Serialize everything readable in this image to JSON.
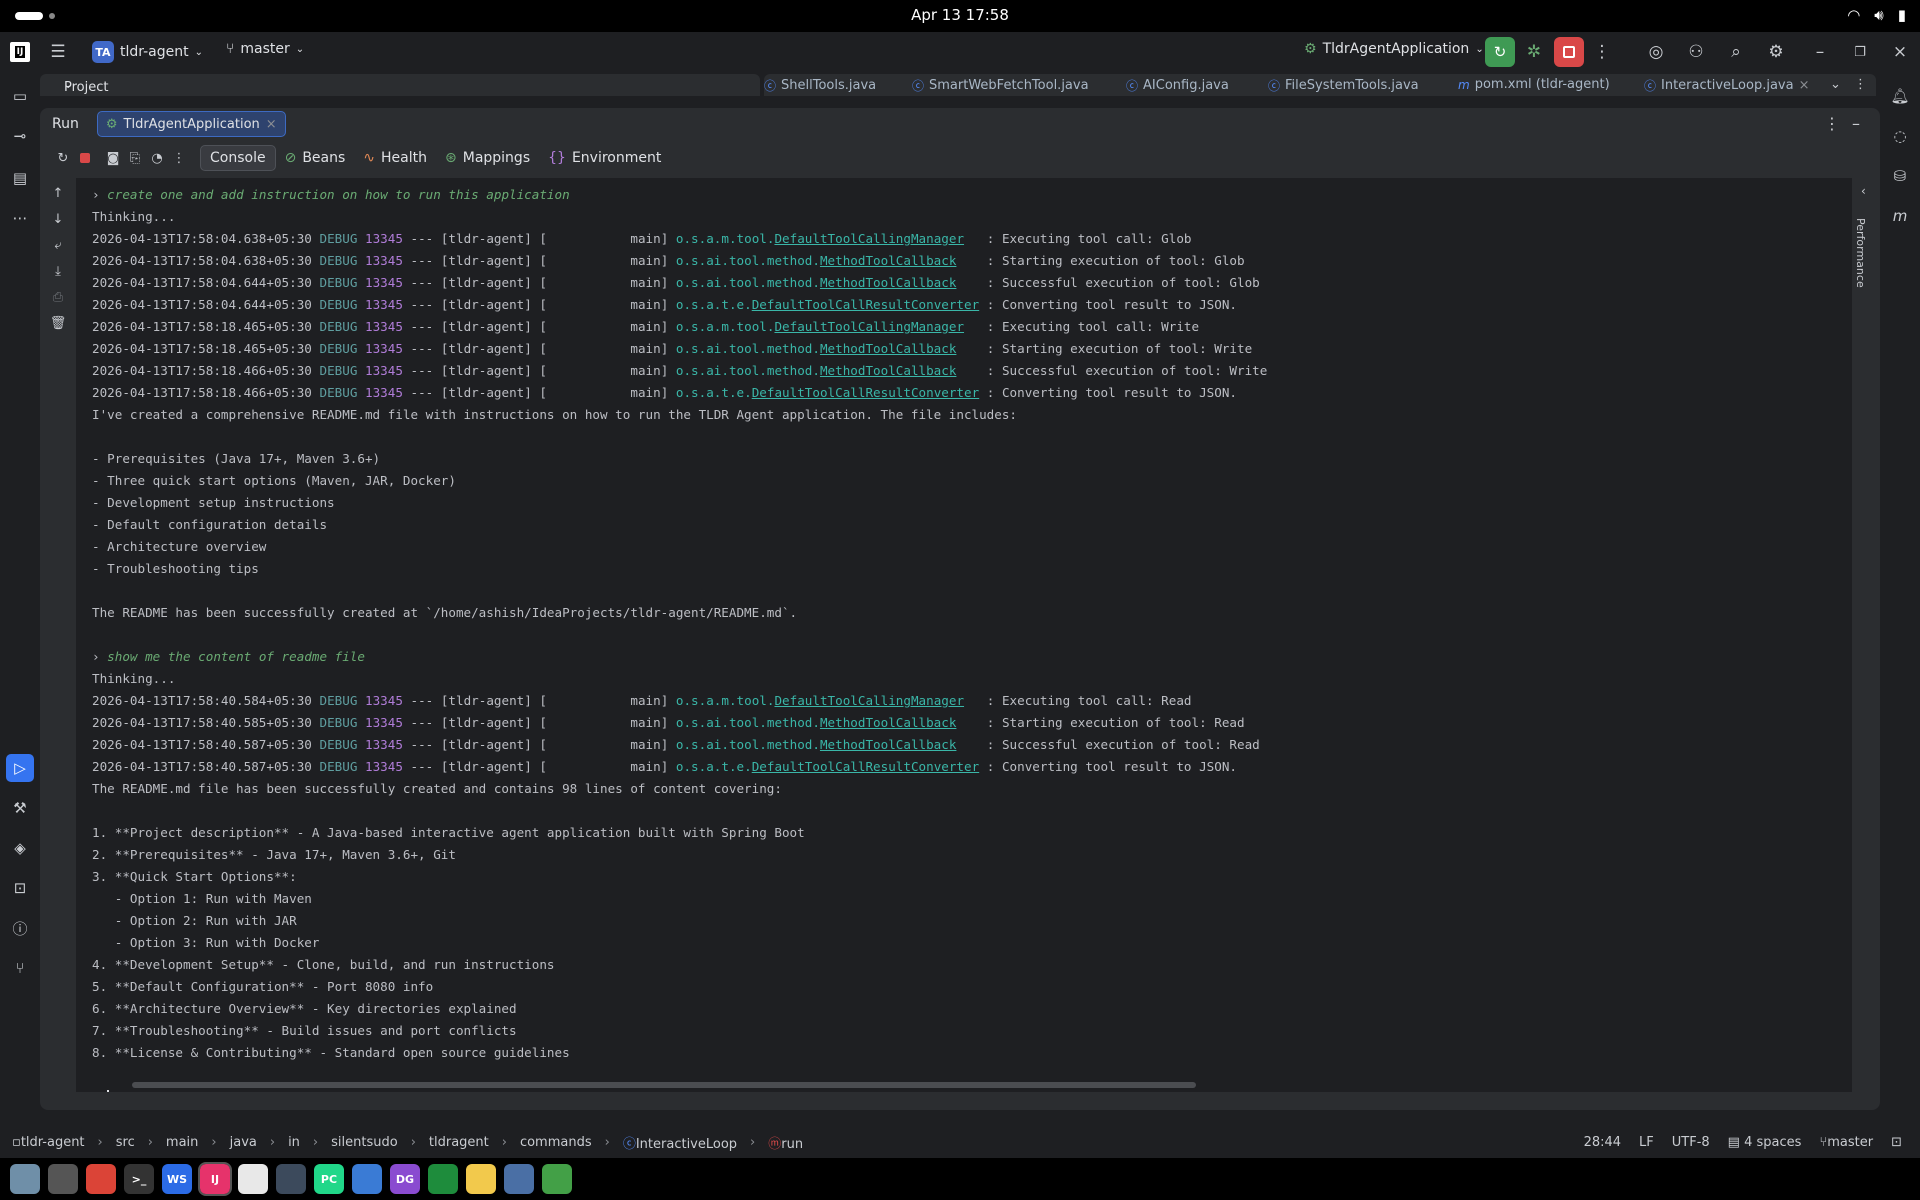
{
  "system": {
    "clock": "Apr 13  17:58"
  },
  "titlebar": {
    "project_badge": "TA",
    "project_name": "tldr-agent",
    "branch": "master",
    "run_config": "TldrAgentApplication"
  },
  "project_panel": {
    "label": "Project"
  },
  "editor_tabs": [
    "ShellTools.java",
    "SmartWebFetchTool.java",
    "AIConfig.java",
    "FileSystemTools.java",
    "pom.xml (tldr-agent)",
    "InteractiveLoop.java"
  ],
  "run": {
    "title": "Run",
    "tab": "TldrAgentApplication",
    "subtabs": [
      "Console",
      "Beans",
      "Health",
      "Mappings",
      "Environment"
    ]
  },
  "performance_label": "Performance",
  "console": {
    "prompt1": "create one and add instruction on how to run this application",
    "thinking": "Thinking...",
    "block1": [
      {
        "ts": "2026-04-13T17:58:04.638+05:30",
        "pkg": "o.s.a.m.tool.",
        "cls": "DefaultToolCallingManager",
        "pad": "   ",
        "msg": ": Executing tool call: Glob"
      },
      {
        "ts": "2026-04-13T17:58:04.638+05:30",
        "pkg": "o.s.ai.tool.method.",
        "cls": "MethodToolCallback",
        "pad": "    ",
        "msg": ": Starting execution of tool: Glob"
      },
      {
        "ts": "2026-04-13T17:58:04.644+05:30",
        "pkg": "o.s.ai.tool.method.",
        "cls": "MethodToolCallback",
        "pad": "    ",
        "msg": ": Successful execution of tool: Glob"
      },
      {
        "ts": "2026-04-13T17:58:04.644+05:30",
        "pkg": "o.s.a.t.e.",
        "cls": "DefaultToolCallResultConverter",
        "pad": " ",
        "msg": ": Converting tool result to JSON."
      },
      {
        "ts": "2026-04-13T17:58:18.465+05:30",
        "pkg": "o.s.a.m.tool.",
        "cls": "DefaultToolCallingManager",
        "pad": "   ",
        "msg": ": Executing tool call: Write"
      },
      {
        "ts": "2026-04-13T17:58:18.465+05:30",
        "pkg": "o.s.ai.tool.method.",
        "cls": "MethodToolCallback",
        "pad": "    ",
        "msg": ": Starting execution of tool: Write"
      },
      {
        "ts": "2026-04-13T17:58:18.466+05:30",
        "pkg": "o.s.ai.tool.method.",
        "cls": "MethodToolCallback",
        "pad": "    ",
        "msg": ": Successful execution of tool: Write"
      },
      {
        "ts": "2026-04-13T17:58:18.466+05:30",
        "pkg": "o.s.a.t.e.",
        "cls": "DefaultToolCallResultConverter",
        "pad": " ",
        "msg": ": Converting tool result to JSON."
      }
    ],
    "log_level": "DEBUG",
    "log_pid": "13345",
    "log_mid": " --- [tldr-agent] [           main] ",
    "text1": [
      "I've created a comprehensive README.md file with instructions on how to run the TLDR Agent application. The file includes:",
      "",
      "- Prerequisites (Java 17+, Maven 3.6+)",
      "- Three quick start options (Maven, JAR, Docker)",
      "- Development setup instructions",
      "- Default configuration details",
      "- Architecture overview",
      "- Troubleshooting tips",
      "",
      "The README has been successfully created at `/home/ashish/IdeaProjects/tldr-agent/README.md`.",
      ""
    ],
    "prompt2": "show me the content of readme file",
    "block2": [
      {
        "ts": "2026-04-13T17:58:40.584+05:30",
        "pkg": "o.s.a.m.tool.",
        "cls": "DefaultToolCallingManager",
        "pad": "   ",
        "msg": ": Executing tool call: Read"
      },
      {
        "ts": "2026-04-13T17:58:40.585+05:30",
        "pkg": "o.s.ai.tool.method.",
        "cls": "MethodToolCallback",
        "pad": "    ",
        "msg": ": Starting execution of tool: Read"
      },
      {
        "ts": "2026-04-13T17:58:40.587+05:30",
        "pkg": "o.s.ai.tool.method.",
        "cls": "MethodToolCallback",
        "pad": "    ",
        "msg": ": Successful execution of tool: Read"
      },
      {
        "ts": "2026-04-13T17:58:40.587+05:30",
        "pkg": "o.s.a.t.e.",
        "cls": "DefaultToolCallResultConverter",
        "pad": " ",
        "msg": ": Converting tool result to JSON."
      }
    ],
    "text2": [
      "The README.md file has been successfully created and contains 98 lines of content covering:",
      "",
      "1. **Project description** - A Java-based interactive agent application built with Spring Boot",
      "2. **Prerequisites** - Java 17+, Maven 3.6+, Git",
      "3. **Quick Start Options**:",
      "   - Option 1: Run with Maven",
      "   - Option 2: Run with JAR",
      "   - Option 3: Run with Docker",
      "4. **Development Setup** - Clone, build, and run instructions",
      "5. **Default Configuration** - Port 8080 info",
      "6. **Architecture Overview** - Key directories explained",
      "7. **Troubleshooting** - Build issues and port conflicts",
      "8. **License & Contributing** - Standard open source guidelines",
      ""
    ]
  },
  "statusbar": {
    "breadcrumbs": [
      "tldr-agent",
      "src",
      "main",
      "java",
      "in",
      "silentsudo",
      "tldragent",
      "commands",
      "InteractiveLoop",
      "run"
    ],
    "position": "28:44",
    "line_sep": "LF",
    "encoding": "UTF-8",
    "indent": "4 spaces",
    "branch": "master"
  },
  "taskbar": {
    "apps": [
      "files-icon",
      "settings-icon",
      "chrome-icon",
      "terminal-icon",
      "webstorm-icon",
      "intellij-icon",
      "editor-icon",
      "monitor-icon",
      "pycharm-icon",
      "cloud-icon",
      "datagrip-icon",
      "mongodb-icon",
      "notes-icon",
      "vpn-icon",
      "trash-icon"
    ],
    "labels": [
      "",
      "",
      "",
      ">_",
      "WS",
      "IJ",
      "",
      "",
      "PC",
      "",
      "DG",
      "",
      "",
      "",
      ""
    ]
  }
}
